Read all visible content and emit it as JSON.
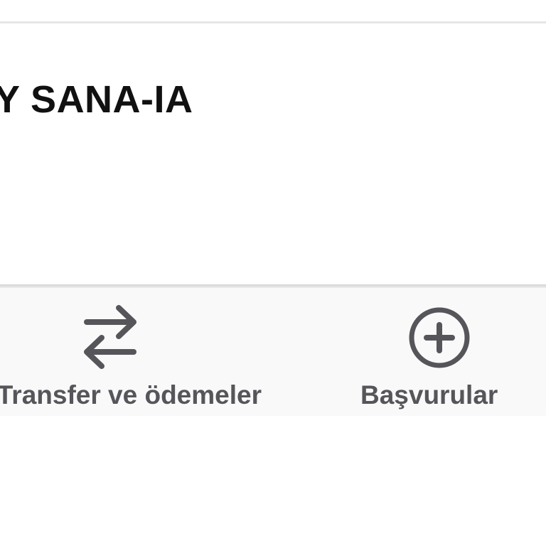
{
  "account": {
    "name": "Y SANA-IA"
  },
  "bottom_nav": {
    "items": [
      {
        "label": "Transfer ve ödemeler",
        "icon": "swap-arrows-icon"
      },
      {
        "label": "Başvurular",
        "icon": "plus-circle-icon"
      }
    ]
  },
  "colors": {
    "nav_icon": "#55555a",
    "nav_label": "#55555a",
    "title_text": "#111111",
    "nav_background": "#f9f9fa",
    "divider": "#d4d4d6"
  }
}
